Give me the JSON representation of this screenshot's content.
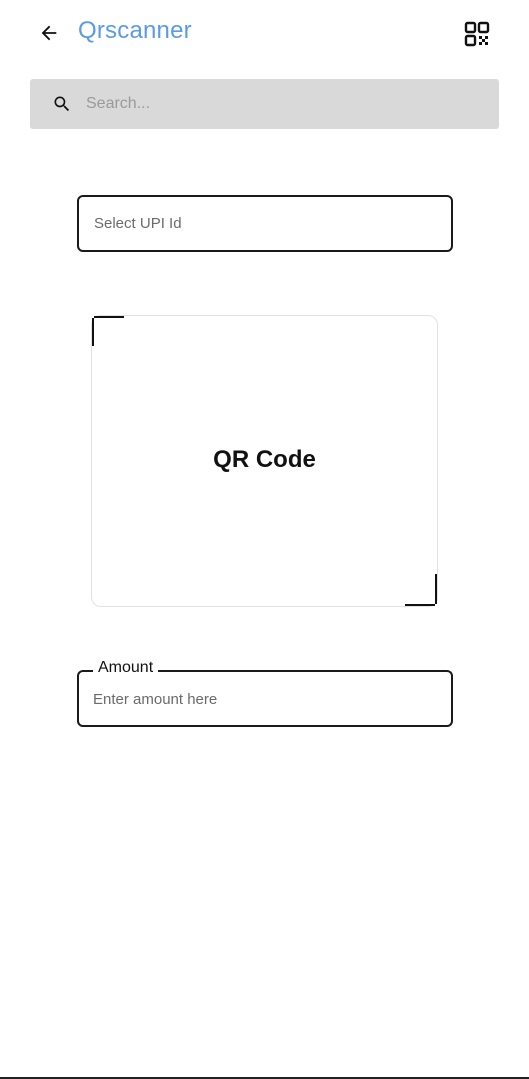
{
  "header": {
    "title": "Qrscanner",
    "back_icon": "arrow-left-icon",
    "qr_icon": "qr-code-icon",
    "title_color": "#5b9be6"
  },
  "search": {
    "placeholder": "Search...",
    "value": "",
    "icon": "search-icon",
    "background": "#d9d9d9"
  },
  "upi": {
    "placeholder": "Select UPI Id"
  },
  "qr_box": {
    "label": "QR Code"
  },
  "amount": {
    "label": "Amount",
    "placeholder": "Enter amount here",
    "value": ""
  }
}
